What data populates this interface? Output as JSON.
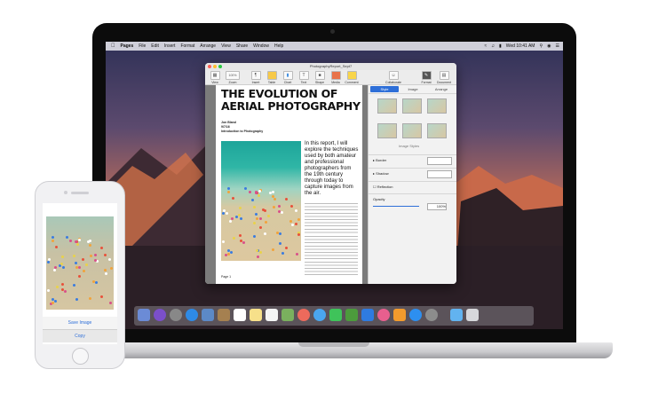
{
  "menubar": {
    "app": "Pages",
    "items": [
      "File",
      "Edit",
      "Insert",
      "Format",
      "Arrange",
      "View",
      "Share",
      "Window",
      "Help"
    ],
    "datetime": "Wed 10:41 AM"
  },
  "window": {
    "title": "PhotographyReport_Sept7",
    "toolbar": [
      "View",
      "Zoom",
      "Insert",
      "Table",
      "Chart",
      "Text",
      "Shape",
      "Media",
      "Comment",
      "Collaborate",
      "Format",
      "Document"
    ],
    "zoom_value": "100%"
  },
  "document": {
    "title_line1": "THE EVOLUTION OF",
    "title_line2": "AERIAL PHOTOGRAPHY",
    "author": "Jon Bland",
    "date": "9/7/16",
    "course": "Introduction to Photography",
    "intro": "In this report, I will explore the techniques used by both amateur and professional photographers from the 19th century through today to capture images from the air.",
    "page_label": "Page 1"
  },
  "inspector": {
    "tabs": [
      "Style",
      "Image",
      "Arrange"
    ],
    "styles_label": "Image Styles",
    "border_label": "Border",
    "shadow_label": "Shadow",
    "reflection_label": "Reflection",
    "opacity_label": "Opacity",
    "opacity_value": "100%"
  },
  "phone": {
    "save_label": "Save Image",
    "copy_label": "Copy"
  },
  "colors": {
    "accent": "#2e6fd8"
  }
}
